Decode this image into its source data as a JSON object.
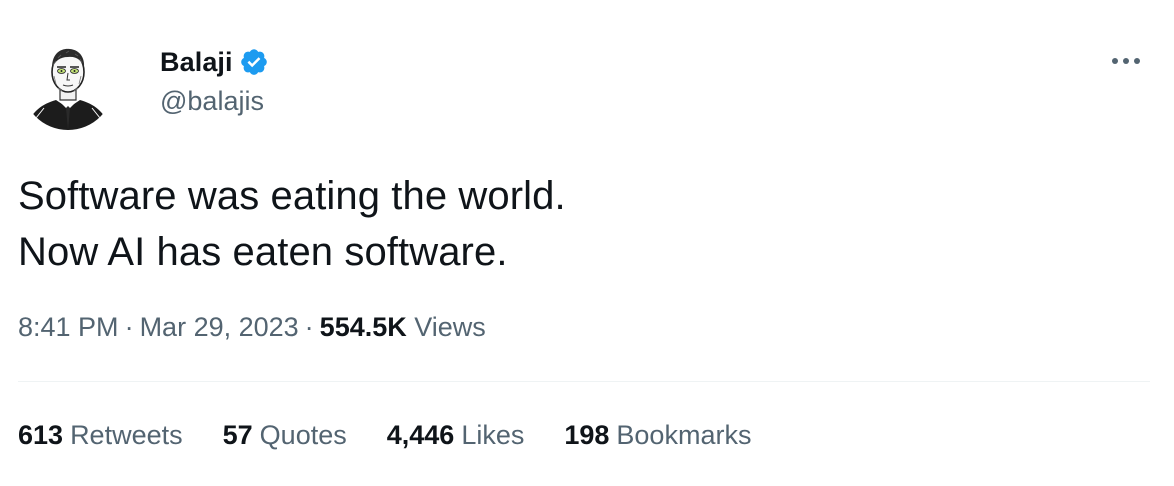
{
  "author": {
    "display_name": "Balaji",
    "handle": "@balajis",
    "verified_icon": "verified-badge-icon",
    "verified_color": "#1d9bf0",
    "avatar": "sketch-portrait-avatar"
  },
  "menu": {
    "more_icon": "more-horizontal-icon"
  },
  "tweet": {
    "lines": [
      "Software was eating the world.",
      "Now AI has eaten software."
    ]
  },
  "meta": {
    "time": "8:41 PM",
    "separator": "·",
    "date": "Mar 29, 2023",
    "views_count": "554.5K",
    "views_label": "Views"
  },
  "stats": [
    {
      "count": "613",
      "label": "Retweets"
    },
    {
      "count": "57",
      "label": "Quotes"
    },
    {
      "count": "4,446",
      "label": "Likes"
    },
    {
      "count": "198",
      "label": "Bookmarks"
    }
  ],
  "colors": {
    "text_primary": "#0f1419",
    "text_secondary": "#536471",
    "divider": "#eff3f4",
    "accent": "#1d9bf0"
  }
}
